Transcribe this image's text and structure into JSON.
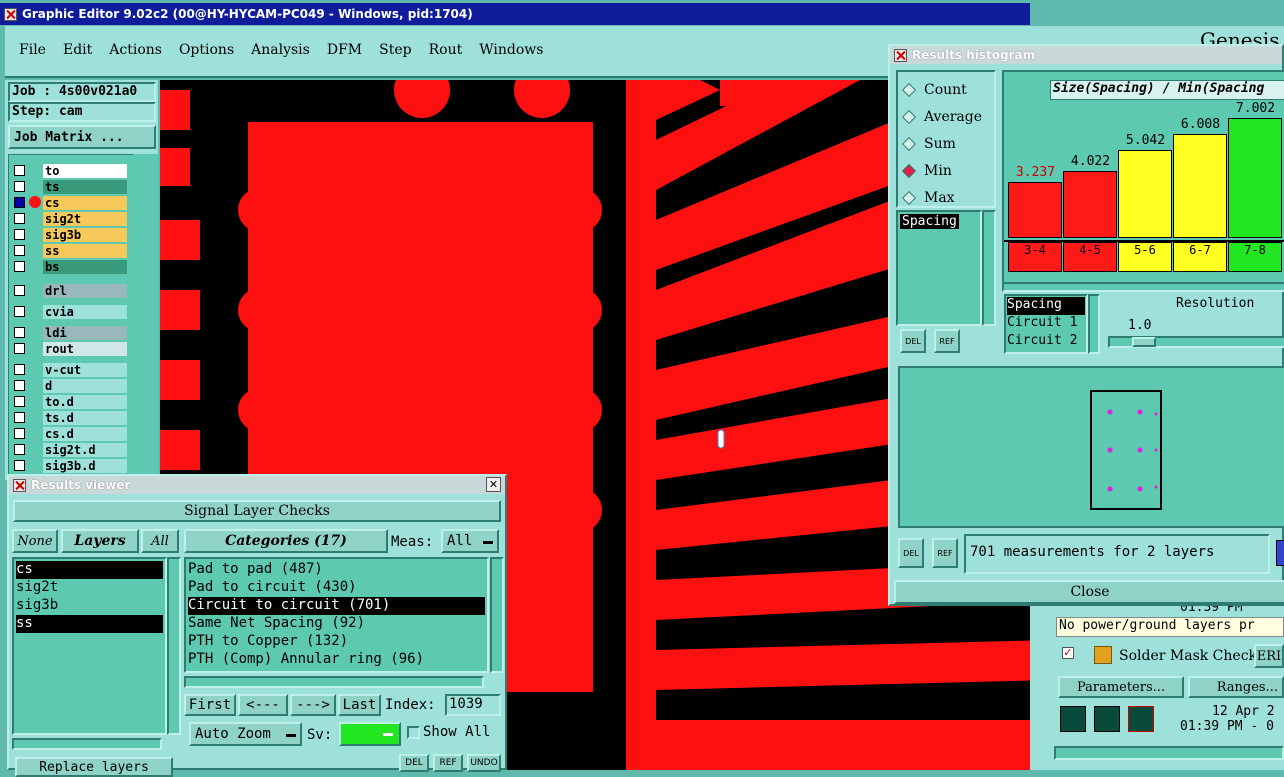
{
  "window": {
    "title": "Graphic Editor 9.02c2 (00@HY-HYCAM-PC049 - Windows, pid:1704)"
  },
  "menu": [
    "File",
    "Edit",
    "Actions",
    "Options",
    "Analysis",
    "DFM",
    "Step",
    "Rout",
    "Windows"
  ],
  "job": {
    "job_label": "Job : 4s00v021a0",
    "step_label": "Step: cam",
    "matrix_button": "Job Matrix ..."
  },
  "layers": [
    {
      "name": "to",
      "color": "#ffffff"
    },
    {
      "name": "ts",
      "color": "#3a9a7c"
    },
    {
      "name": "cs",
      "color": "#f7c85a"
    },
    {
      "name": "sig2t",
      "color": "#f7c85a"
    },
    {
      "name": "sig3b",
      "color": "#f7c85a"
    },
    {
      "name": "ss",
      "color": "#f7c85a"
    },
    {
      "name": "bs",
      "color": "#3a9a7c"
    },
    {
      "name": "drl",
      "color": "#99b8bc"
    },
    {
      "name": "cvia",
      "color": "#9ee0da"
    },
    {
      "name": "ldi",
      "color": "#99b8bc"
    },
    {
      "name": "rout",
      "color": "#cfe7e6"
    },
    {
      "name": "v-cut",
      "color": "#9ee0da"
    },
    {
      "name": "d",
      "color": "#9ee0da"
    },
    {
      "name": "to.d",
      "color": "#9ee0da"
    },
    {
      "name": "ts.d",
      "color": "#9ee0da"
    },
    {
      "name": "cs.d",
      "color": "#9ee0da"
    },
    {
      "name": "sig2t.d",
      "color": "#9ee0da"
    },
    {
      "name": "sig3b.d",
      "color": "#9ee0da"
    }
  ],
  "results_viewer": {
    "title": "Results viewer",
    "heading": "Signal Layer Checks",
    "none_btn": "None",
    "layers_btn": "Layers",
    "all_btn": "All",
    "layers": [
      "cs",
      "sig2t",
      "sig3b",
      "ss"
    ],
    "categories_btn": "Categories (17)",
    "meas_label": "Meas:",
    "meas_value": "All",
    "categories": [
      "Pad to pad (487)",
      "Pad to circuit (430)",
      "Circuit to circuit (701)",
      "Same Net Spacing (92)",
      "PTH to Copper (132)",
      "PTH (Comp) Annular ring (96)"
    ],
    "first": "First",
    "prev": "<---",
    "next": "--->",
    "last": "Last",
    "index_label": "Index:",
    "index_value": "1039",
    "zoom": "Auto Zoom",
    "sv_label": "Sv:",
    "show_all": "Show All",
    "replace": "Replace layers",
    "del": "DEL",
    "ref": "REF",
    "undo": "UNDO"
  },
  "histogram": {
    "title": "Results histogram",
    "options": [
      "Count",
      "Average",
      "Sum",
      "Min",
      "Max"
    ],
    "selected_option": "Min",
    "measure_list": [
      "Spacing"
    ],
    "chart_title": "Size(Spacing) / Min(Spacing",
    "bars": [
      {
        "value": "3.237",
        "range": "3-4",
        "color": "#ff1a1a",
        "frac": 0.35
      },
      {
        "value": "4.022",
        "range": "4-5",
        "color": "#ff1a1a",
        "frac": 0.42
      },
      {
        "value": "5.042",
        "range": "5-6",
        "color": "#ffff22",
        "frac": 0.55
      },
      {
        "value": "6.008",
        "range": "6-7",
        "color": "#ffff22",
        "frac": 0.65
      },
      {
        "value": "7.002",
        "range": "7-8",
        "color": "#22e622",
        "frac": 0.75
      }
    ],
    "attributes": [
      "Spacing",
      "Circuit 1",
      "Circuit 2"
    ],
    "resolution_label": "Resolution",
    "resolution_value": "1.0",
    "summary": "701 measurements for 2 layers",
    "close": "Close",
    "del": "DEL",
    "ref": "REF"
  },
  "erf_panel": {
    "brand": "Genesis",
    "time1": "01:39 PM",
    "status": "No power/ground layers pr",
    "check_name": "Solder Mask Checks",
    "erf": "ERI",
    "params": "Parameters...",
    "ranges": "Ranges...",
    "date": "12 Apr 2",
    "time2": "01:39 PM - 0"
  }
}
